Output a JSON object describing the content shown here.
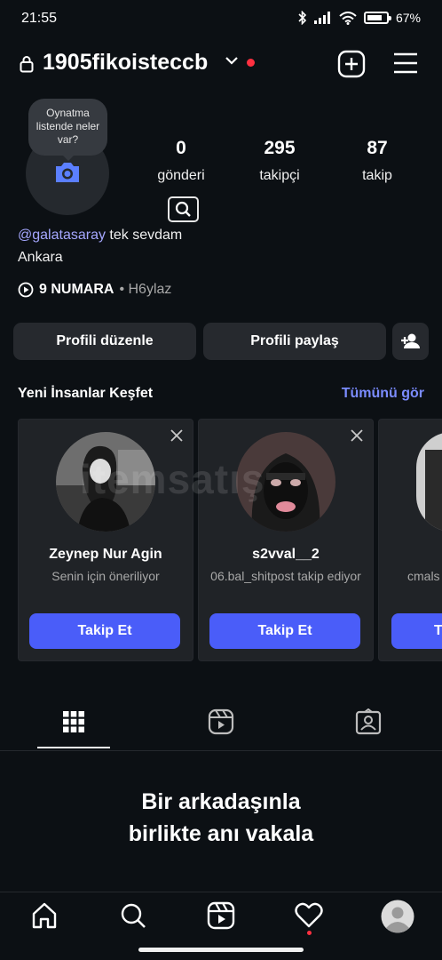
{
  "status_bar": {
    "time": "21:55",
    "battery": "67%"
  },
  "header": {
    "username": "1905fikoisteccb"
  },
  "profile": {
    "note_bubble": "Oynatma listende neler var?",
    "stats": [
      {
        "value": "0",
        "label": "gönderi"
      },
      {
        "value": "295",
        "label": "takipçi"
      },
      {
        "value": "87",
        "label": "takip"
      }
    ],
    "bio_mention": "@galatasaray",
    "bio_text": " tek sevdam",
    "bio_line2": "Ankara",
    "music_song": "9 NUMARA",
    "music_artist": "• H6ylaz"
  },
  "actions": {
    "edit_profile": "Profili düzenle",
    "share_profile": "Profili paylaş"
  },
  "discover": {
    "title": "Yeni İnsanlar Keşfet",
    "see_all": "Tümünü gör",
    "cards": [
      {
        "name": "Zeynep Nur Agin",
        "subtitle": "Senin için öneriliyor",
        "button": "Takip Et"
      },
      {
        "name": "s2vval__2",
        "subtitle": "06.bal_shitpost takip ediyor",
        "button": "Takip Et"
      },
      {
        "name": "",
        "subtitle": "cmals",
        "button": "T"
      }
    ]
  },
  "empty_state": {
    "line1": "Bir arkadaşınla",
    "line2": "birlikte anı vakala"
  },
  "watermark": "itemsatış",
  "colors": {
    "background": "#0c1014",
    "accent": "#4a5df9",
    "link": "#7b8cff",
    "notification": "#ff3040"
  }
}
